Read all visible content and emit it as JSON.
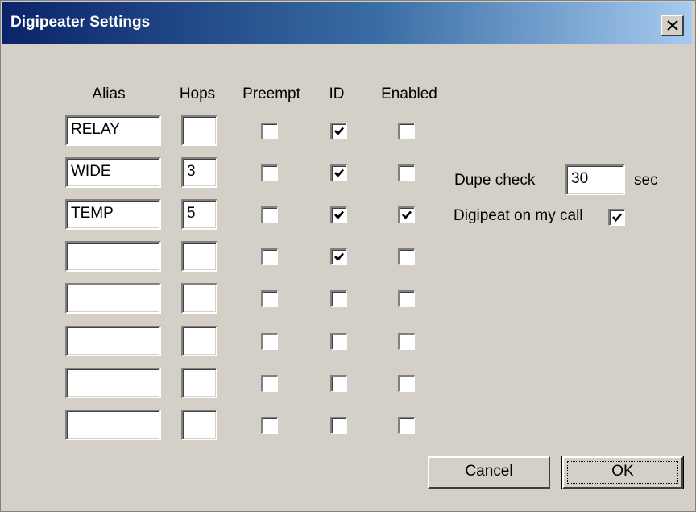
{
  "window": {
    "title": "Digipeater Settings"
  },
  "columns": {
    "alias": "Alias",
    "hops": "Hops",
    "preempt": "Preempt",
    "id": "ID",
    "enabled": "Enabled"
  },
  "rows": [
    {
      "alias": "RELAY",
      "hops": "",
      "preempt": false,
      "id": true,
      "enabled": false
    },
    {
      "alias": "WIDE",
      "hops": "3",
      "preempt": false,
      "id": true,
      "enabled": false
    },
    {
      "alias": "TEMP",
      "hops": "5",
      "preempt": false,
      "id": true,
      "enabled": true
    },
    {
      "alias": "",
      "hops": "",
      "preempt": false,
      "id": true,
      "enabled": false
    },
    {
      "alias": "",
      "hops": "",
      "preempt": false,
      "id": false,
      "enabled": false
    },
    {
      "alias": "",
      "hops": "",
      "preempt": false,
      "id": false,
      "enabled": false
    },
    {
      "alias": "",
      "hops": "",
      "preempt": false,
      "id": false,
      "enabled": false
    },
    {
      "alias": "",
      "hops": "",
      "preempt": false,
      "id": false,
      "enabled": false
    }
  ],
  "dupe_check": {
    "label": "Dupe check",
    "value": "30",
    "unit": "sec"
  },
  "digipeat_on_my_call": {
    "label": "Digipeat on my call",
    "checked": true
  },
  "buttons": {
    "cancel": "Cancel",
    "ok": "OK"
  }
}
